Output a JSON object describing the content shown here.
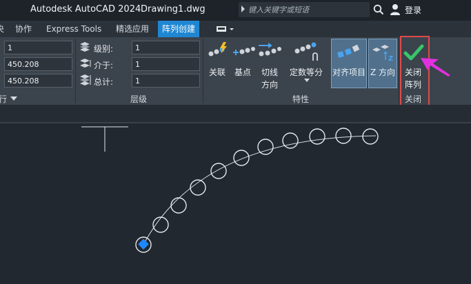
{
  "titlebar": {
    "app_title": "Autodesk AutoCAD 2024",
    "doc_title": "Drawing1.dwg",
    "search_placeholder": "键入关键字或短语",
    "login_label": "登录"
  },
  "tabs": {
    "partial": "央",
    "collaborate": "协作",
    "express_tools": "Express Tools",
    "featured_apps": "精选应用",
    "array_creation": "阵列创建"
  },
  "ribbon": {
    "items_panel": {
      "count_value": "1",
      "between_value": "450.208",
      "total_value": "450.208",
      "panel_title": "行"
    },
    "levels_panel": {
      "levels_label": "级别:",
      "levels_value": "1",
      "between_label": "介于:",
      "between_value": "1",
      "total_label": "总计:",
      "total_value": "1",
      "panel_title": "层级"
    },
    "properties_panel": {
      "associative": "关联",
      "base_point": "基点",
      "tangent_direction_1": "切线",
      "tangent_direction_2": "方向",
      "measure_divide": "定数等分",
      "align_items": "对齐项目",
      "z_direction": "Z 方向",
      "panel_title": "特性"
    },
    "close_panel": {
      "close_array_1": "关闭",
      "close_array_2": "阵列",
      "panel_title": "关闭"
    }
  },
  "colors": {
    "accent": "#1f86d2",
    "highlight_box": "#e04a4a",
    "pointer_arrow": "#e230e0",
    "check": "#3ac46a",
    "grip": "#1e88ff"
  }
}
